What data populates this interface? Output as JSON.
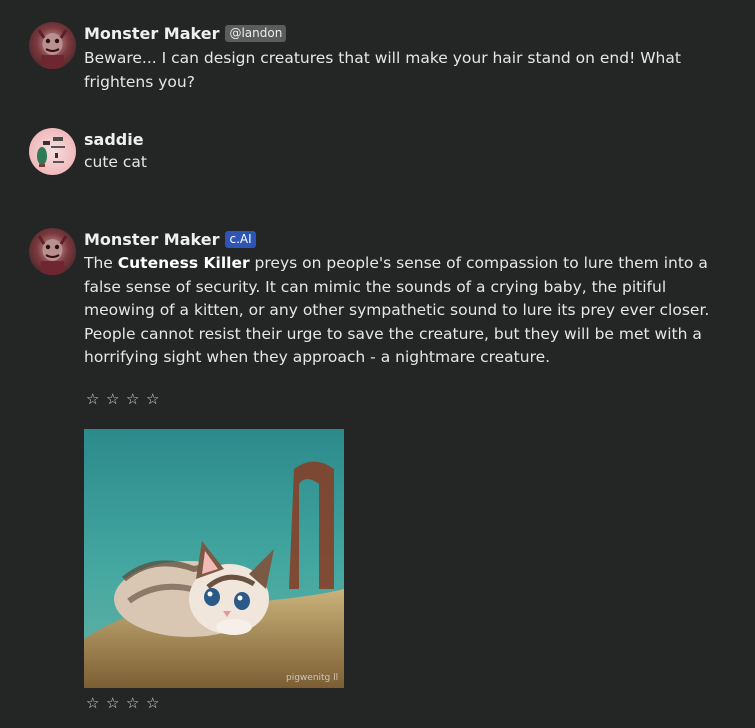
{
  "messages": [
    {
      "author": "Monster Maker",
      "badge": "@landon",
      "text": "Beware... I can design creatures that will make your hair stand on end! What frightens you?"
    },
    {
      "author": "saddie",
      "text": "cute cat"
    },
    {
      "author": "Monster Maker",
      "badge": "c.AI",
      "bold_lead": "Cuteness Killer",
      "text_before": "The ",
      "text_after": " preys on people's sense of compassion to lure them into a false sense of security. It can mimic the sounds of a crying baby, the pitiful meowing of a kitten, or any other sympathetic sound to lure its prey ever closer. People cannot resist their urge to save the creature, but they will be met with a horrifying sight when they approach - a nightmare creature."
    }
  ],
  "rating": {
    "star_glyph": "☆",
    "count": 4
  },
  "image": {
    "watermark": "pigwenitg ll"
  },
  "colors": {
    "background": "#242625",
    "ai_badge": "#2d55b8",
    "user_badge": "#5b5d5c"
  }
}
